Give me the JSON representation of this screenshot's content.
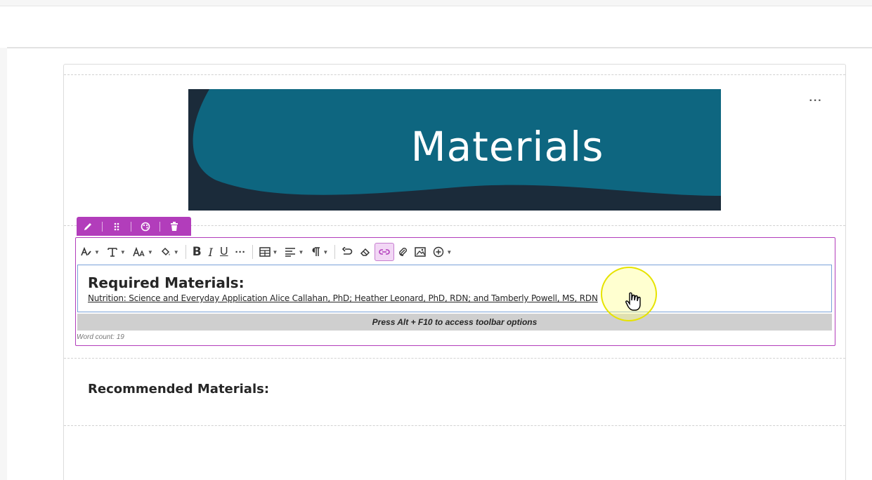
{
  "banner": {
    "title": "Materials",
    "colors": {
      "light": "#0e6680",
      "dark": "#1b2b3a"
    }
  },
  "block_menu": {
    "more_label": "···",
    "tools": [
      "pencil-icon",
      "drag-handle-icon",
      "palette-icon",
      "trash-icon"
    ]
  },
  "toolbar": {
    "items": [
      "text-style",
      "font-family",
      "font-size",
      "text-color",
      "bold",
      "italic",
      "underline",
      "more",
      "table",
      "align",
      "paragraph",
      "undo",
      "clear-format",
      "link",
      "attachment",
      "image",
      "insert"
    ],
    "bold_label": "B",
    "italic_label": "I",
    "underline_label": "U",
    "more_label": "···",
    "active_item": "link"
  },
  "editor": {
    "heading": "Required Materials:",
    "link_text": "Nutrition: Science and Everyday Application Alice Callahan, PhD; Heather Leonard, PhD, RDN; and Tamberly Powell, MS, RDN",
    "help_text": "Press Alt + F10 to access toolbar options",
    "word_count": "Word count: 19"
  },
  "section2": {
    "heading": "Recommended Materials:"
  },
  "colors": {
    "accent": "#b23dbb",
    "focus": "#7aa2d9",
    "cursor_highlight": "#ffff66"
  }
}
